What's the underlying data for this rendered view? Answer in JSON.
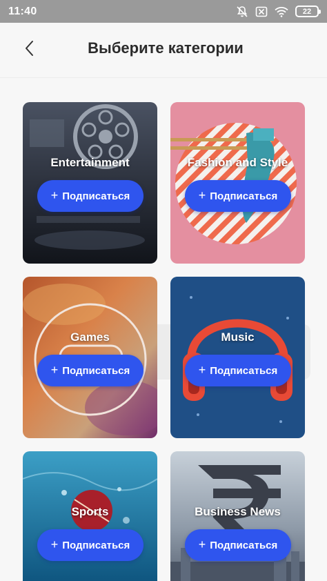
{
  "status_bar": {
    "time": "11:40",
    "battery": "22",
    "icons": [
      "notifications-muted-icon",
      "sim-disabled-icon",
      "wifi-icon",
      "battery-icon"
    ]
  },
  "header": {
    "back_icon": "chevron-left-icon",
    "title": "Выберите категории"
  },
  "categories": [
    {
      "title": "Entertainment",
      "button": "Подписаться"
    },
    {
      "title": "Fashion and Style",
      "button": "Подписаться"
    },
    {
      "title": "Games",
      "button": "Подписаться"
    },
    {
      "title": "Music",
      "button": "Подписаться"
    },
    {
      "title": "Sports",
      "button": "Подписаться"
    },
    {
      "title": "Business News",
      "button": "Подписаться"
    }
  ],
  "colors": {
    "accent": "#2f55ee",
    "status_bar": "#9a9a9a",
    "background": "#f7f7f7"
  }
}
